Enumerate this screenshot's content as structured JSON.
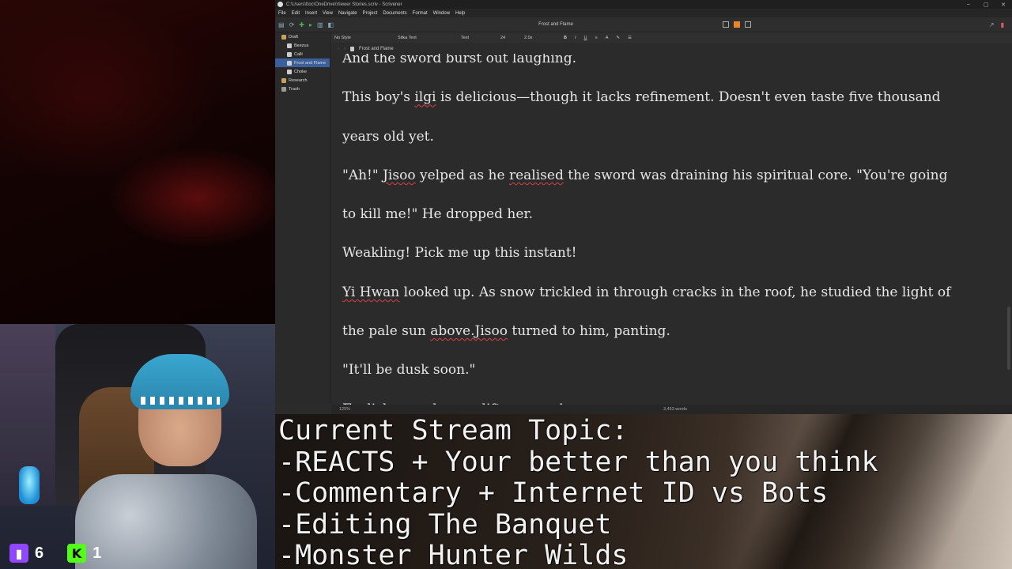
{
  "app": {
    "window_title": "C:\\Users\\ttoc\\OneDrive\\Viewer Stories.scriv - Scrivener",
    "menu": [
      "File",
      "Edit",
      "Insert",
      "View",
      "Navigate",
      "Project",
      "Documents",
      "Format",
      "Window",
      "Help"
    ],
    "document_title": "Frost and Flame",
    "binder": [
      {
        "label": "Draft",
        "level": 0,
        "icon": "folder"
      },
      {
        "label": "Beezus",
        "level": 1,
        "icon": "doc"
      },
      {
        "label": "Calli",
        "level": 1,
        "icon": "doc"
      },
      {
        "label": "Frost and Flame",
        "level": 1,
        "icon": "doc",
        "selected": true
      },
      {
        "label": "Choke",
        "level": 1,
        "icon": "doc"
      },
      {
        "label": "Research",
        "level": 0,
        "icon": "folder"
      },
      {
        "label": "Trash",
        "level": 0,
        "icon": "trash"
      }
    ],
    "format_bar": {
      "style": "No Style",
      "font": "Sitka Text",
      "weight": "Text",
      "size": "24",
      "spacing": "2.0x"
    },
    "header_title": "Frost and Flame",
    "footer": {
      "zoom": "125%",
      "word_count": "3,453 words"
    },
    "editor": {
      "lines": [
        "And the sword burst out laughing.",
        "This boy's ilgi is delicious—though it lacks refinement. Doesn't even taste five thousand",
        "years old yet.",
        "\"Ah!\" Jisoo yelped as he realised the sword was draining his spiritual core. \"You're going",
        "to kill me!\" He dropped her.",
        "Weakling! Pick me up this instant!",
        "Yi Hwan looked up. As snow trickled in through cracks in the roof, he studied the light of",
        "the pale sun above.Jisoo turned to him, panting.",
        "\"It'll be dusk soon.\"",
        "Foolish swordsman, lift me now!"
      ]
    }
  },
  "stream": {
    "topic_lines": [
      "Current Stream Topic:",
      "-REACTS + Your better than you think",
      "-Commentary + Internet ID vs Bots",
      "-Editing The Banquet",
      "-Monster Hunter Wilds"
    ],
    "viewers": {
      "twitch": "6",
      "kick": "1"
    },
    "colors": {
      "twitch": "#9146ff",
      "kick": "#53fc18"
    }
  }
}
